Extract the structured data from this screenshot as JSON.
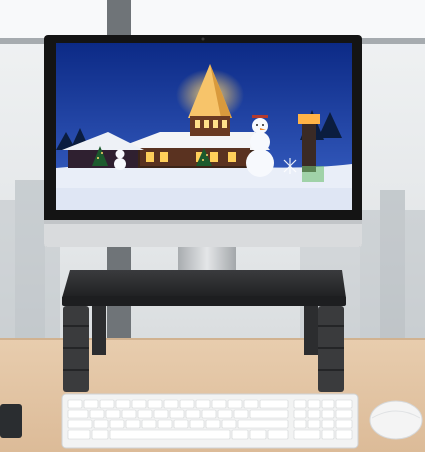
{
  "scene": {
    "subject": "monitor-riser-stand-product-photo",
    "objects": [
      "window-background",
      "monitor",
      "winter-village-wallpaper",
      "monitor-stand-riser",
      "keyboard",
      "mouse",
      "desk"
    ]
  },
  "colors": {
    "desk": "#e5c7a5",
    "riser_top": "#2a2b2d",
    "riser_legs": "#3a3b3d",
    "monitor_bezel": "#141414",
    "monitor_chin": "#d9dbdd",
    "sky": "#15369a",
    "snow": "#e9eef8",
    "keyboard": "#f2f3f3",
    "mouse": "#f4f4f4"
  }
}
